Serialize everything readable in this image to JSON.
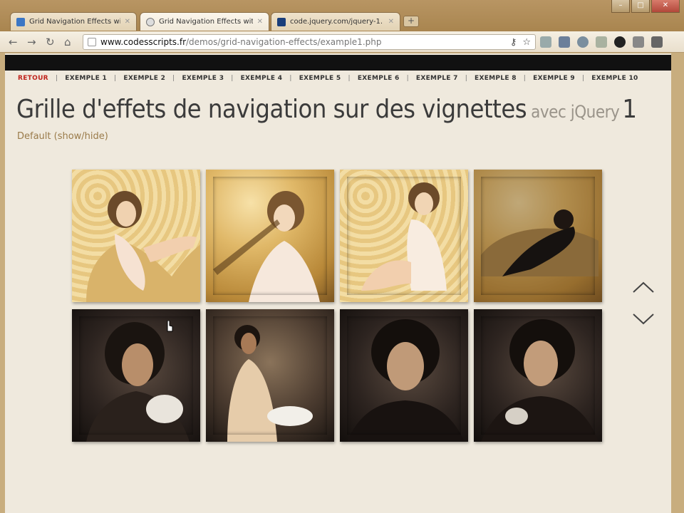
{
  "browser": {
    "tabs": [
      {
        "title": "Grid Navigation Effects wit",
        "favicon": "page-icon",
        "active": false
      },
      {
        "title": "Grid Navigation Effects wit",
        "favicon": "page-icon",
        "active": true
      },
      {
        "title": "code.jquery.com/jquery-1.",
        "favicon": "page-icon",
        "active": false
      }
    ],
    "url_domain": "www.codesscripts.fr",
    "url_path": "/demos/grid-navigation-effects/example1.php"
  },
  "nav": {
    "items": [
      "RETOUR",
      "EXEMPLE 1",
      "EXEMPLE 2",
      "EXEMPLE 3",
      "EXEMPLE 4",
      "EXEMPLE 5",
      "EXEMPLE 6",
      "EXEMPLE 7",
      "EXEMPLE 8",
      "EXEMPLE 9",
      "EXEMPLE 10"
    ],
    "separator": "|"
  },
  "heading": {
    "main": "Grille d'effets de navigation sur des vignettes",
    "avec": "avec jQuery",
    "num": "1"
  },
  "subtitle": "Default (show/hide)",
  "grid": {
    "tiles": [
      {
        "tone": "gold",
        "icon": "photo-thumbnail"
      },
      {
        "tone": "gold",
        "icon": "photo-thumbnail"
      },
      {
        "tone": "gold",
        "icon": "photo-thumbnail"
      },
      {
        "tone": "gold",
        "icon": "photo-thumbnail"
      },
      {
        "tone": "dark",
        "icon": "photo-thumbnail"
      },
      {
        "tone": "darkwarm",
        "icon": "photo-thumbnail"
      },
      {
        "tone": "dark",
        "icon": "photo-thumbnail"
      },
      {
        "tone": "dark",
        "icon": "photo-thumbnail"
      }
    ]
  },
  "colors": {
    "accent": "#c0241d",
    "page_bg": "#efe9dd"
  }
}
